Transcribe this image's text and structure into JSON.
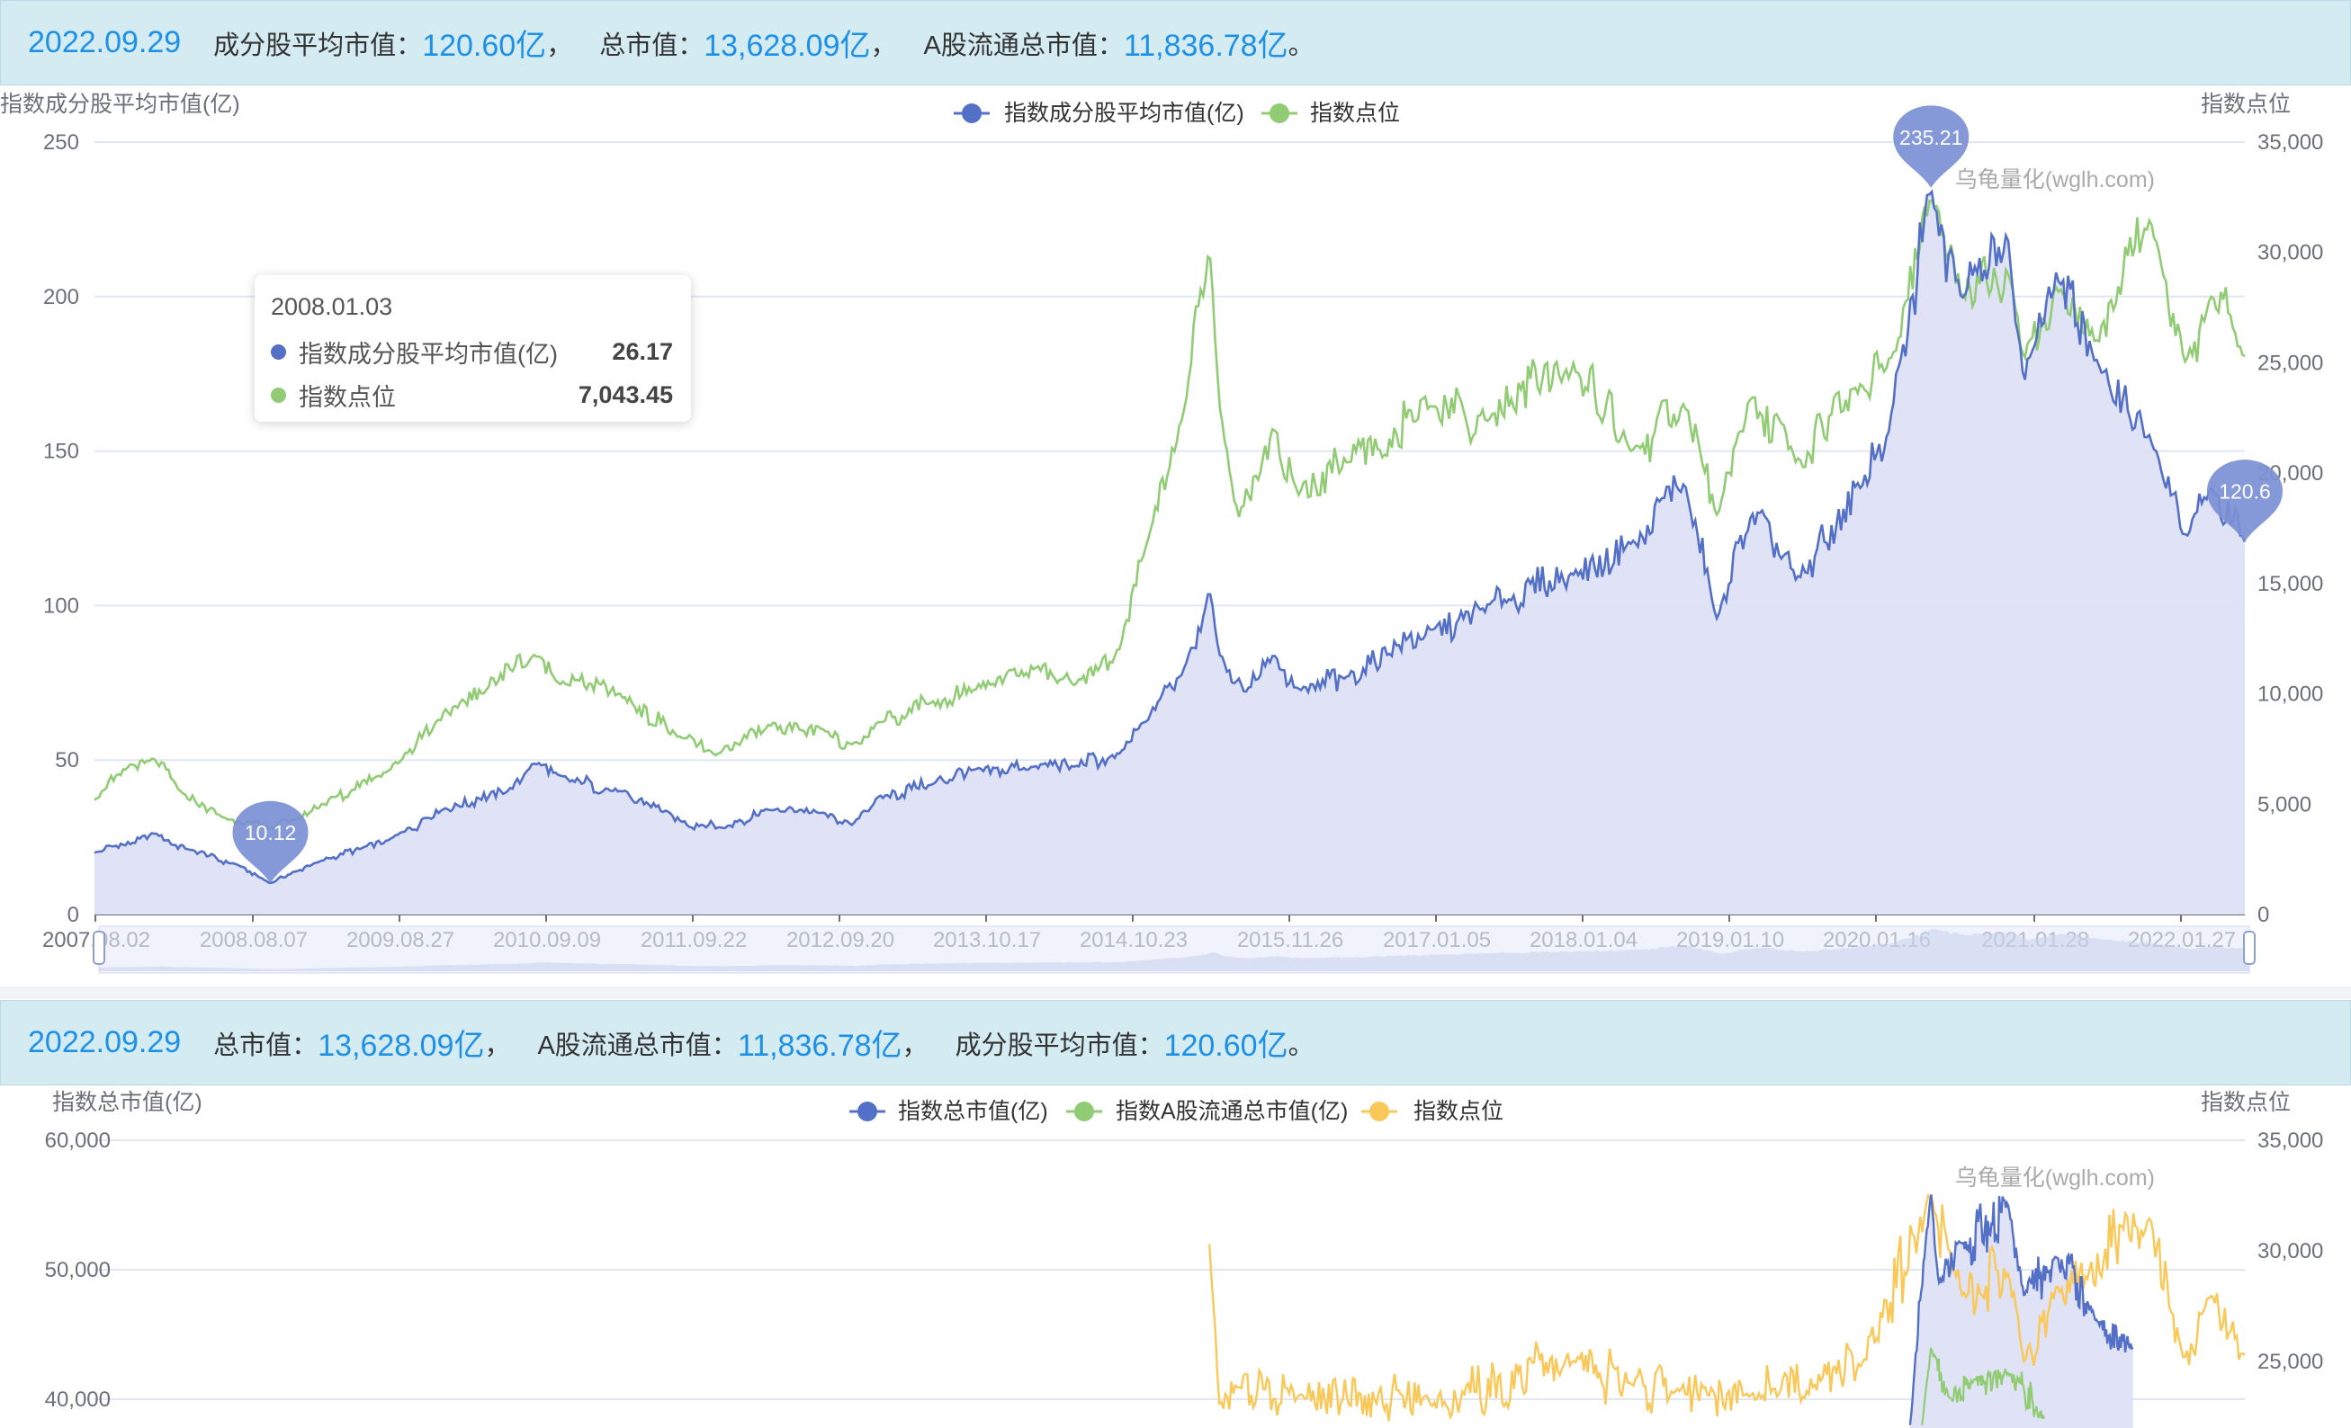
{
  "top_banner": {
    "date": "2022.09.29",
    "avg_label": "成分股平均市值：",
    "avg_value": "120.60亿",
    "total_label": "总市值：",
    "total_value": "13,628.09亿",
    "float_label": "A股流通总市值：",
    "float_value": "11,836.78亿",
    "end": "。"
  },
  "bottom_banner": {
    "date": "2022.09.29",
    "total_label": "总市值：",
    "total_value": "13,628.09亿",
    "float_label": "A股流通总市值：",
    "float_value": "11,836.78亿",
    "avg_label": "成分股平均市值：",
    "avg_value": "120.60亿",
    "end": "。"
  },
  "tooltip": {
    "date": "2008.01.03",
    "rows": [
      {
        "name": "指数成分股平均市值(亿)",
        "value": "26.17"
      },
      {
        "name": "指数点位",
        "value": "7,043.45"
      }
    ]
  },
  "watermark": "乌龟量化(wglh.com)",
  "colors": {
    "blue": "#5470c6",
    "green": "#91cc75",
    "yellow": "#fac858",
    "area": "#dde2f4",
    "pin": "#7b8fd4"
  },
  "chart_data": [
    {
      "type": "line",
      "title": "",
      "ylabel": "指数成分股平均市值(亿)",
      "ylabel_right": "指数点位",
      "y_ticks": [
        "0",
        "50",
        "100",
        "150",
        "200",
        "250"
      ],
      "y2_ticks": [
        "0",
        "5,000",
        "10,000",
        "15,000",
        "20,000",
        "25,000",
        "30,000",
        "35,000"
      ],
      "ylim": [
        0,
        250
      ],
      "y2lim": [
        0,
        35000
      ],
      "x_ticks": [
        "2007.08.02",
        "2008.08.07",
        "2009.08.27",
        "2010.09.09",
        "2011.09.22",
        "2012.09.20",
        "2013.10.17",
        "2014.10.23",
        "2015.11.26",
        "2017.01.05",
        "2018.01.04",
        "2019.01.10",
        "2020.01.16",
        "2021.01.28",
        "2022.01.27"
      ],
      "x_tick_display": [
        "2007.08.02",
        "2008.08.07",
        "2009.08.27",
        "2010.09.09",
        "2011.09.22",
        "2012.09.20",
        "2013.10.17",
        "2014.10.23",
        "2015.11.26",
        "2017.01.05",
        "2018.01.04",
        "2019.01.10",
        "2020.01.16",
        "2021.01.28",
        "2022.01.27"
      ],
      "legend_position": "top-center",
      "grid": true,
      "markers": [
        {
          "label": "10.12",
          "date": "2008.10.28",
          "value": 10.12
        },
        {
          "label": "235.21",
          "date": "2020.07.13",
          "value": 235.21
        },
        {
          "label": "120.6",
          "date": "2022.09.29",
          "value": 120.6
        }
      ],
      "series": [
        {
          "name": "指数成分股平均市值(亿)",
          "axis": "left",
          "x": [
            "2007.08.02",
            "2008.01.03",
            "2008.04.01",
            "2008.08.07",
            "2008.10.28",
            "2009.03.01",
            "2009.08.27",
            "2010.01.15",
            "2010.07.01",
            "2010.09.09",
            "2010.11.10",
            "2011.04.15",
            "2011.09.22",
            "2012.01.06",
            "2012.05.04",
            "2012.09.20",
            "2012.12.04",
            "2013.02.08",
            "2013.06.25",
            "2013.10.17",
            "2014.03.20",
            "2014.07.01",
            "2014.10.23",
            "2015.01.05",
            "2015.04.10",
            "2015.06.12",
            "2015.07.08",
            "2015.09.15",
            "2015.11.26",
            "2016.01.28",
            "2016.06.01",
            "2017.01.05",
            "2017.06.01",
            "2018.01.04",
            "2018.06.01",
            "2018.10.18",
            "2019.01.10",
            "2019.04.08",
            "2019.08.01",
            "2020.01.16",
            "2020.03.23",
            "2020.07.13",
            "2020.10.01",
            "2021.01.28",
            "2021.03.09",
            "2021.06.01",
            "2021.09.15",
            "2022.01.27",
            "2022.04.26",
            "2022.07.05",
            "2022.09.29"
          ],
          "values": [
            20,
            26.17,
            21,
            16,
            10.12,
            17,
            24,
            34,
            40,
            49,
            45,
            40,
            30,
            28,
            34,
            33,
            29,
            38,
            42,
            47,
            48,
            48,
            52,
            63,
            80,
            105,
            84,
            72,
            84,
            73,
            77,
            92,
            100,
            110,
            120,
            139,
            95,
            130,
            108,
            138,
            155,
            235.21,
            200,
            218,
            172,
            208,
            178,
            155,
            122,
            138,
            120.6
          ]
        },
        {
          "name": "指数点位",
          "axis": "right",
          "x": [
            "2007.08.02",
            "2007.11.01",
            "2008.01.03",
            "2008.03.15",
            "2008.06.30",
            "2008.10.28",
            "2009.01.01",
            "2009.08.27",
            "2010.01.01",
            "2010.09.09",
            "2010.11.10",
            "2011.04.15",
            "2011.09.22",
            "2011.12.20",
            "2012.05.04",
            "2012.09.20",
            "2012.12.04",
            "2013.02.08",
            "2013.06.25",
            "2013.10.17",
            "2014.03.20",
            "2014.07.01",
            "2014.10.23",
            "2015.01.05",
            "2015.04.10",
            "2015.06.12",
            "2015.07.08",
            "2015.08.26",
            "2015.11.26",
            "2016.01.28",
            "2016.06.01",
            "2017.01.05",
            "2017.06.01",
            "2018.01.04",
            "2018.06.01",
            "2018.10.18",
            "2019.01.10",
            "2019.04.08",
            "2019.08.01",
            "2020.01.16",
            "2020.03.23",
            "2020.07.13",
            "2020.10.01",
            "2021.01.28",
            "2021.03.09",
            "2021.06.01",
            "2021.09.15",
            "2022.01.27",
            "2022.04.26",
            "2022.07.05",
            "2022.09.29"
          ],
          "values": [
            5200,
            6800,
            7043.45,
            5500,
            4400,
            3900,
            4300,
            6500,
            8800,
            11800,
            10500,
            10000,
            8000,
            7200,
            8600,
            8400,
            7700,
            8700,
            9600,
            10200,
            11200,
            10400,
            12000,
            17000,
            23000,
            30300,
            23000,
            18000,
            22000,
            19000,
            20500,
            23000,
            22500,
            25000,
            21000,
            23000,
            18000,
            23500,
            20500,
            24000,
            24800,
            32500,
            28000,
            29000,
            25000,
            28500,
            26000,
            31500,
            25000,
            28000,
            25300
          ]
        }
      ]
    },
    {
      "type": "line",
      "title": "",
      "ylabel": "指数总市值(亿)",
      "ylabel_right": "指数点位",
      "y_ticks": [
        "40,000",
        "50,000",
        "60,000"
      ],
      "y2_ticks": [
        "25,000",
        "30,000",
        "35,000"
      ],
      "y_visible_range": [
        37500,
        60000
      ],
      "y2_visible_range": [
        23700,
        35000
      ],
      "watermark": "乌龟量化(wglh.com)",
      "legend_position": "top-center",
      "grid": true,
      "series": [
        {
          "name": "指数总市值(亿)",
          "axis": "left",
          "x": [
            "2020.05.20",
            "2020.07.13",
            "2020.08.01",
            "2020.10.01",
            "2021.01.28",
            "2021.03.09",
            "2021.06.01",
            "2021.09.15",
            "2021.12.15"
          ],
          "values": [
            38000,
            56000,
            49000,
            52000,
            55000,
            48000,
            51000,
            46000,
            44000
          ]
        },
        {
          "name": "指数A股流通总市值(亿)",
          "axis": "left",
          "x": [
            "2020.06.20",
            "2020.07.13",
            "2020.09.01",
            "2020.11.01",
            "2021.01.28",
            "2021.05.01"
          ],
          "values": [
            38000,
            44000,
            40000,
            41500,
            42000,
            38500
          ]
        },
        {
          "name": "指数点位",
          "axis": "right",
          "x": [
            "2015.06.12",
            "2015.07.08",
            "2015.08.26",
            "2016.01.28",
            "2017.01.05",
            "2018.01.04",
            "2018.06.01",
            "2019.04.08",
            "2020.01.16",
            "2020.07.13",
            "2020.10.01",
            "2021.01.28",
            "2021.03.09",
            "2021.06.01",
            "2022.01.27",
            "2022.04.26",
            "2022.07.05",
            "2022.09.29"
          ],
          "values": [
            30300,
            23000,
            23900,
            23500,
            23000,
            25000,
            23900,
            23500,
            24800,
            32500,
            28000,
            29000,
            25000,
            28500,
            31500,
            25000,
            28000,
            25300
          ]
        }
      ]
    }
  ]
}
